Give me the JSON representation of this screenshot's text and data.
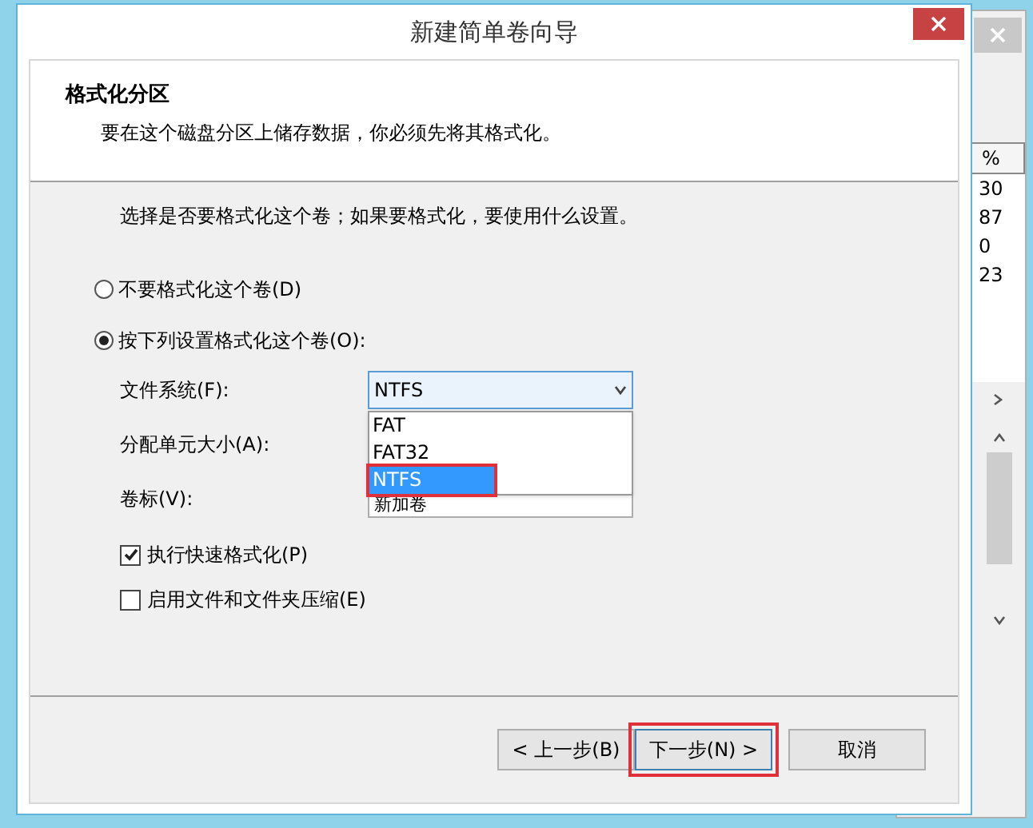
{
  "window": {
    "title": "新建简单卷向导"
  },
  "header": {
    "title": "格式化分区",
    "subtitle": "要在这个磁盘分区上储存数据，你必须先将其格式化。"
  },
  "prompt": "选择是否要格式化这个卷；如果要格式化，要使用什么设置。",
  "format_options": [
    {
      "label": "不要格式化这个卷(D)",
      "selected": false
    },
    {
      "label": "按下列设置格式化这个卷(O):",
      "selected": true
    }
  ],
  "file_system": {
    "label": "文件系统(F):",
    "value": "NTFS",
    "expanded": true,
    "options": [
      {
        "label": "FAT",
        "selected": false,
        "annotated": false
      },
      {
        "label": "FAT32",
        "selected": false,
        "annotated": false
      },
      {
        "label": "NTFS",
        "selected": true,
        "annotated": true
      }
    ]
  },
  "allocation_unit": {
    "label": "分配单元大小(A):"
  },
  "volume_label": {
    "label": "卷标(V):",
    "value": "新加卷"
  },
  "checkboxes": [
    {
      "label": "执行快速格式化(P)",
      "checked": true
    },
    {
      "label": "启用文件和文件夹压缩(E)",
      "checked": false
    }
  ],
  "buttons": [
    {
      "label": "< 上一步(B)",
      "annotated": false
    },
    {
      "label": "下一步(N) >",
      "annotated": true
    },
    {
      "label": "取消",
      "annotated": false
    }
  ],
  "background_window": {
    "column": "%",
    "values": [
      "30",
      "87",
      "0",
      "23"
    ]
  }
}
